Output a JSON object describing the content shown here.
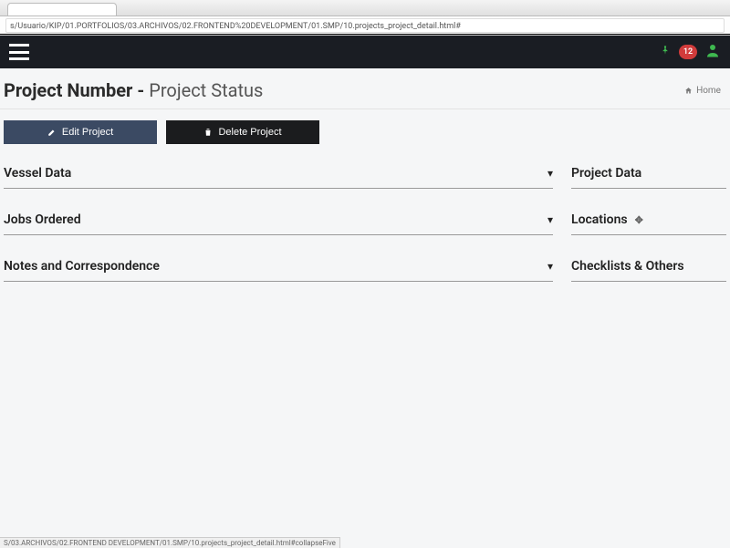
{
  "browser": {
    "url": "s/Usuario/KIP/01.PORTFOLIOS/03.ARCHIVOS/02.FRONTEND%20DEVELOPMENT/01.SMP/10.projects_project_detail.html#",
    "status_url": "S/03.ARCHIVOS/02.FRONTEND DEVELOPMENT/01.SMP/10.projects_project_detail.html#collapseFive"
  },
  "topbar": {
    "badge_count": "12"
  },
  "header": {
    "title_strong": "Project Number",
    "title_sep": " - ",
    "title_light": "Project Status"
  },
  "breadcrumb": {
    "home": "Home"
  },
  "actions": {
    "edit_label": "Edit Project",
    "delete_label": "Delete Project"
  },
  "left_panels": [
    {
      "title": "Vessel Data"
    },
    {
      "title": "Jobs Ordered"
    },
    {
      "title": "Notes and Correspondence"
    }
  ],
  "right_panels": [
    {
      "title": "Project Data"
    },
    {
      "title": "Locations"
    },
    {
      "title": "Checklists & Others"
    }
  ]
}
